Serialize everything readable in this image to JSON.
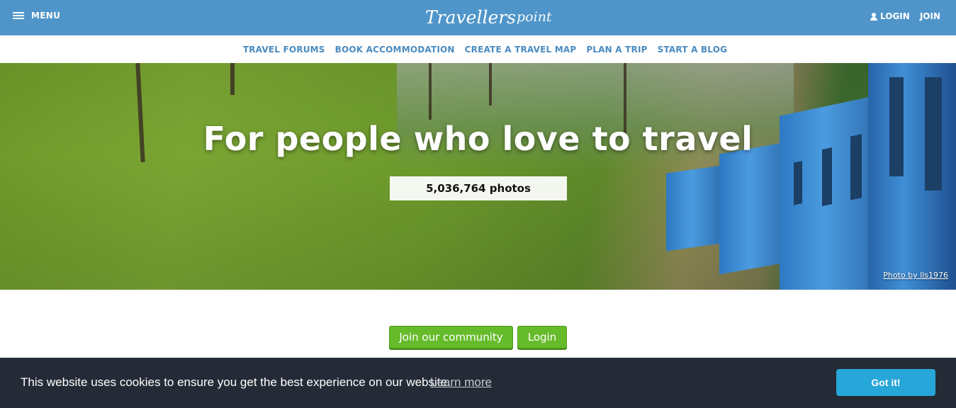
{
  "header": {
    "menu_label": "MENU",
    "logo_main": "Travellers",
    "logo_secondary": "point",
    "login_label": "LOGIN",
    "join_label": "JOIN"
  },
  "subnav": {
    "items": [
      "TRAVEL FORUMS",
      "BOOK ACCOMMODATION",
      "CREATE A TRAVEL MAP",
      "PLAN A TRIP",
      "START A BLOG"
    ]
  },
  "hero": {
    "title": "For people who love to travel",
    "photo_count": "5,036,764 photos",
    "photo_credit": "Photo by lls1976"
  },
  "cta": {
    "join_label": "Join our community",
    "login_label": "Login"
  },
  "cookie": {
    "message": "This website uses cookies to ensure you get the best experience on our website.",
    "learn_more": "Learn more",
    "accept_label": "Got it!"
  },
  "colors": {
    "header_bg": "#4f95c9",
    "nav_link": "#4a8bc0",
    "cta_green": "#66bb2b",
    "cookie_bg": "#252b36",
    "cookie_button": "#27a6d9"
  }
}
